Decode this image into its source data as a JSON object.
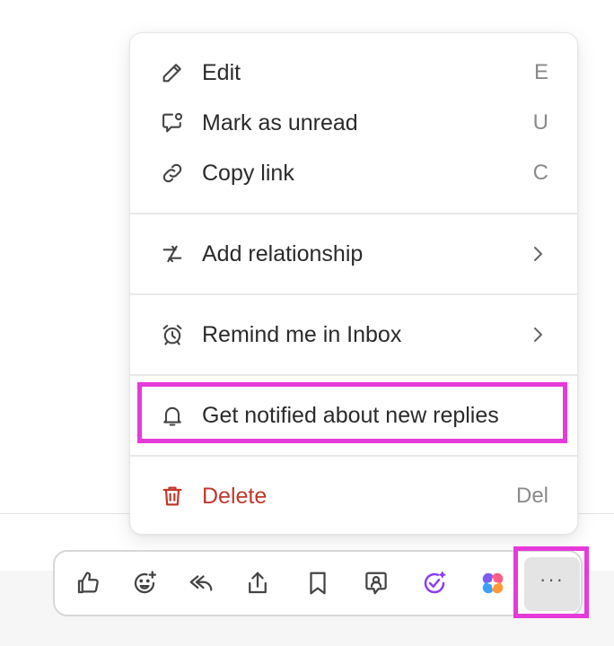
{
  "menu": {
    "items": [
      {
        "label": "Edit",
        "shortcut": "E",
        "icon": "pencil-icon"
      },
      {
        "label": "Mark as unread",
        "shortcut": "U",
        "icon": "chat-unread-icon"
      },
      {
        "label": "Copy link",
        "shortcut": "C",
        "icon": "link-icon"
      },
      {
        "label": "Add relationship",
        "icon": "relationship-arrows-icon",
        "submenu": true
      },
      {
        "label": "Remind me in Inbox",
        "icon": "alarm-clock-icon",
        "submenu": true
      },
      {
        "label": "Get notified about new replies",
        "icon": "bell-icon",
        "highlighted": true
      },
      {
        "label": "Delete",
        "shortcut": "Del",
        "icon": "trash-icon",
        "danger": true
      }
    ]
  },
  "toolbar": {
    "buttons": [
      {
        "icon": "thumbs-up-icon"
      },
      {
        "icon": "add-emoji-icon"
      },
      {
        "icon": "reply-icon"
      },
      {
        "icon": "share-icon"
      },
      {
        "icon": "bookmark-icon"
      },
      {
        "icon": "assign-comment-icon"
      },
      {
        "icon": "ai-check-icon"
      },
      {
        "icon": "ai-sparkle-icon"
      }
    ],
    "more_label": "···"
  },
  "colors": {
    "highlight": "#e63ad9",
    "danger": "#c0392b",
    "ai_purple": "#8b3cf7"
  }
}
